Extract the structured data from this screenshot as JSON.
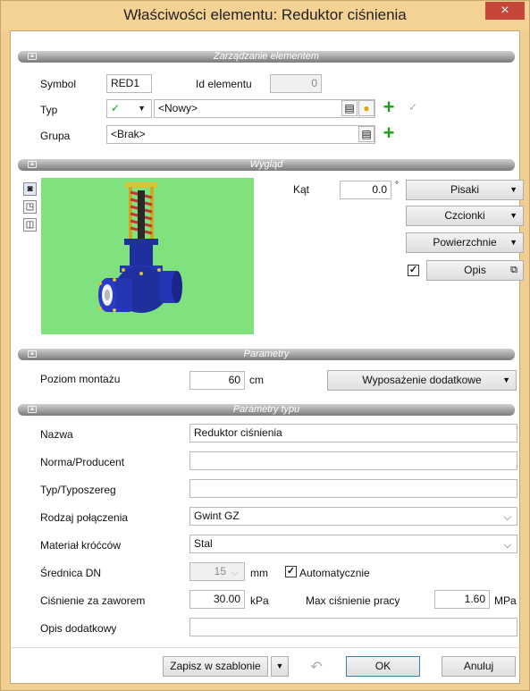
{
  "window": {
    "title": "Właściwości elementu: Reduktor ciśnienia",
    "close": "×"
  },
  "zarzadzanie": {
    "header": "Zarządzanie elementem",
    "symbol_label": "Symbol",
    "symbol_value": "RED1",
    "id_label": "Id elementu",
    "id_value": "0",
    "typ_label": "Typ",
    "typ_check": "✓",
    "typ_value": "<Nowy>",
    "grupa_label": "Grupa",
    "grupa_value": "<Brak>"
  },
  "wyglad": {
    "header": "Wygląd",
    "kat_label": "Kąt",
    "kat_value": "0.0",
    "kat_unit": "°",
    "pisaki": "Pisaki",
    "czcionki": "Czcionki",
    "powierzchnie": "Powierzchnie",
    "opis": "Opis",
    "opis_checked": true
  },
  "parametry": {
    "header": "Parametry",
    "poziom_label": "Poziom montażu",
    "poziom_value": "60",
    "poziom_unit": "cm",
    "wyposazenie": "Wyposażenie dodatkowe"
  },
  "parametry_typu": {
    "header": "Parametry typu",
    "nazwa_label": "Nazwa",
    "nazwa_value": "Reduktor ciśnienia",
    "norma_label": "Norma/Producent",
    "norma_value": "",
    "typ_label": "Typ/Typoszereg",
    "typ_value": "",
    "rodzaj_label": "Rodzaj połączenia",
    "rodzaj_value": "Gwint GZ",
    "material_label": "Materiał króćców",
    "material_value": "Stal",
    "srednica_label": "Średnica DN",
    "srednica_value": "15",
    "srednica_unit": "mm",
    "auto_label": "Automatycznie",
    "auto_checked": true,
    "cisnienie_label": "Ciśnienie za zaworem",
    "cisnienie_value": "30.00",
    "cisnienie_unit": "kPa",
    "max_label": "Max ciśnienie pracy",
    "max_value": "1.60",
    "max_unit": "MPa",
    "opis_label": "Opis dodatkowy",
    "opis_value": ""
  },
  "footer": {
    "zapisz": "Zapisz w szablonie",
    "ok": "OK",
    "anuluj": "Anuluj"
  },
  "colors": {
    "frame": "#f0cf92",
    "close": "#c7463a",
    "preview_bg": "#7fe27f",
    "valve_body": "#1f2f9e",
    "plus": "#1ca01c"
  }
}
